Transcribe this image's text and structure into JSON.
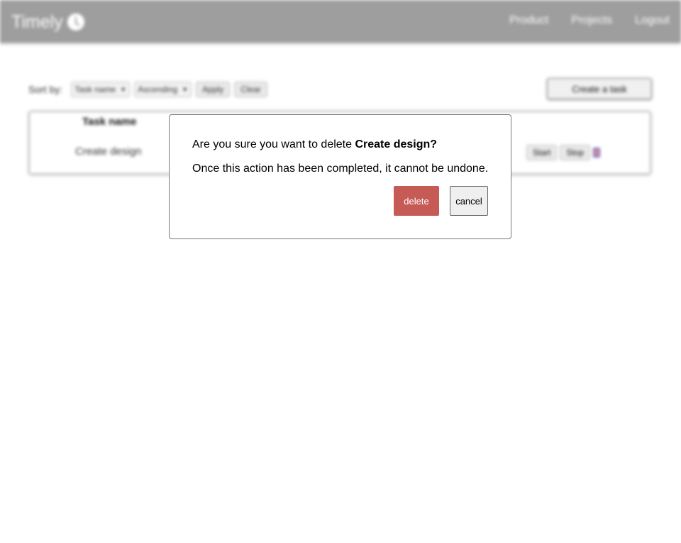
{
  "app": {
    "brand": "Timely",
    "brand_icon": "clock-icon",
    "nav": [
      "Product",
      "Projects",
      "Logout"
    ]
  },
  "toolbar": {
    "sort_label": "Sort by:",
    "sort_field": "Task name",
    "sort_order": "Ascending",
    "apply_label": "Apply",
    "clear_label": "Clear",
    "create_label": "Create a task"
  },
  "table": {
    "header_name": "Task name",
    "rows": [
      {
        "name": "Create design",
        "start_label": "Start",
        "stop_label": "Stop",
        "delete_icon": "trash-icon"
      }
    ]
  },
  "dialog": {
    "question_prefix": "Are you sure you want to delete ",
    "task_name": "Create design?",
    "warning": "Once this action has been completed, it cannot be undone.",
    "delete_label": "delete",
    "cancel_label": "cancel"
  },
  "colors": {
    "navbar": "#9e9e9e",
    "delete_button": "#c65a55",
    "trash_icon_border": "#6d6dcc"
  }
}
